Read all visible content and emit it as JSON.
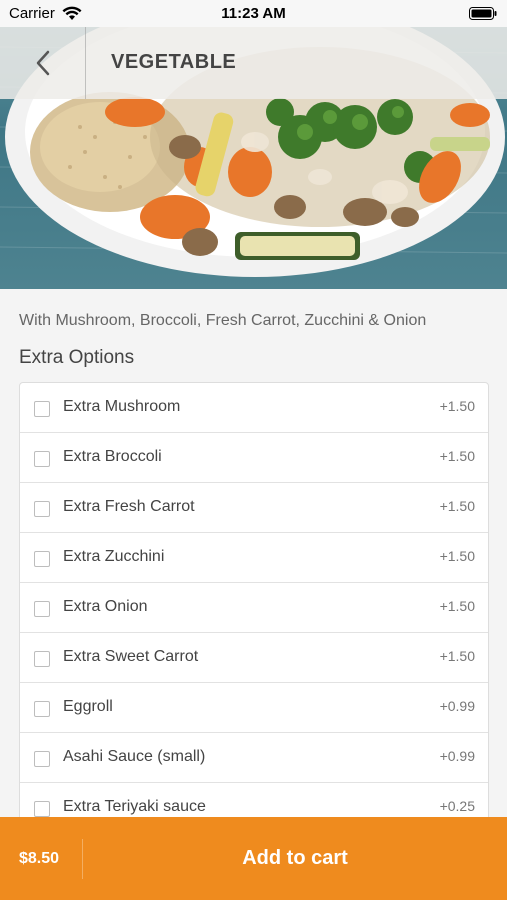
{
  "status_bar": {
    "carrier": "Carrier",
    "time": "11:23 AM"
  },
  "nav": {
    "title": "VEGETABLE",
    "back_icon": "chevron-left-icon"
  },
  "description": "With Mushroom, Broccoli, Fresh Carrot, Zucchini & Onion",
  "extras": {
    "title": "Extra Options",
    "items": [
      {
        "label": "Extra Mushroom",
        "price": "+1.50"
      },
      {
        "label": "Extra Broccoli",
        "price": "+1.50"
      },
      {
        "label": "Extra Fresh Carrot",
        "price": "+1.50"
      },
      {
        "label": "Extra Zucchini",
        "price": "+1.50"
      },
      {
        "label": "Extra Onion",
        "price": "+1.50"
      },
      {
        "label": "Extra Sweet Carrot",
        "price": "+1.50"
      },
      {
        "label": "Eggroll",
        "price": "+0.99"
      },
      {
        "label": "Asahi Sauce (small)",
        "price": "+0.99"
      },
      {
        "label": "Extra Teriyaki sauce",
        "price": "+0.25"
      }
    ]
  },
  "cart": {
    "total": "$8.50",
    "add_label": "Add to cart"
  },
  "colors": {
    "accent": "#ef8b1e",
    "background": "#f4f4f4"
  }
}
